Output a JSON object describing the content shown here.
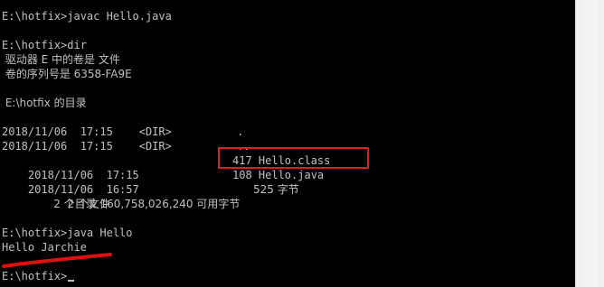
{
  "console": {
    "lines": [
      "E:\\hotfix>javac Hello.java",
      "",
      "E:\\hotfix>dir",
      " 驱动器 E 中的卷是 文件",
      " 卷的序列号是 6358-FA9E",
      "",
      " E:\\hotfix 的目录",
      "",
      "2018/11/06  17:15    <DIR>          .",
      "2018/11/06  17:15    <DIR>          ..",
      "2018/11/06  17:15",
      "2018/11/06  16:57",
      "               2 个文件",
      "               2 个目录 160,758,026,240 可用字节",
      "",
      "E:\\hotfix>java Hello",
      "Hello Jarchie",
      "",
      "E:\\hotfix>"
    ],
    "file_rows": {
      "class_size_name": "417 Hello.class",
      "java_size_name": "108 Hello.java",
      "files_bytes": "525 字节"
    }
  },
  "annotation_colors": {
    "highlight_box": "#e02020",
    "underline": "#e01010"
  }
}
